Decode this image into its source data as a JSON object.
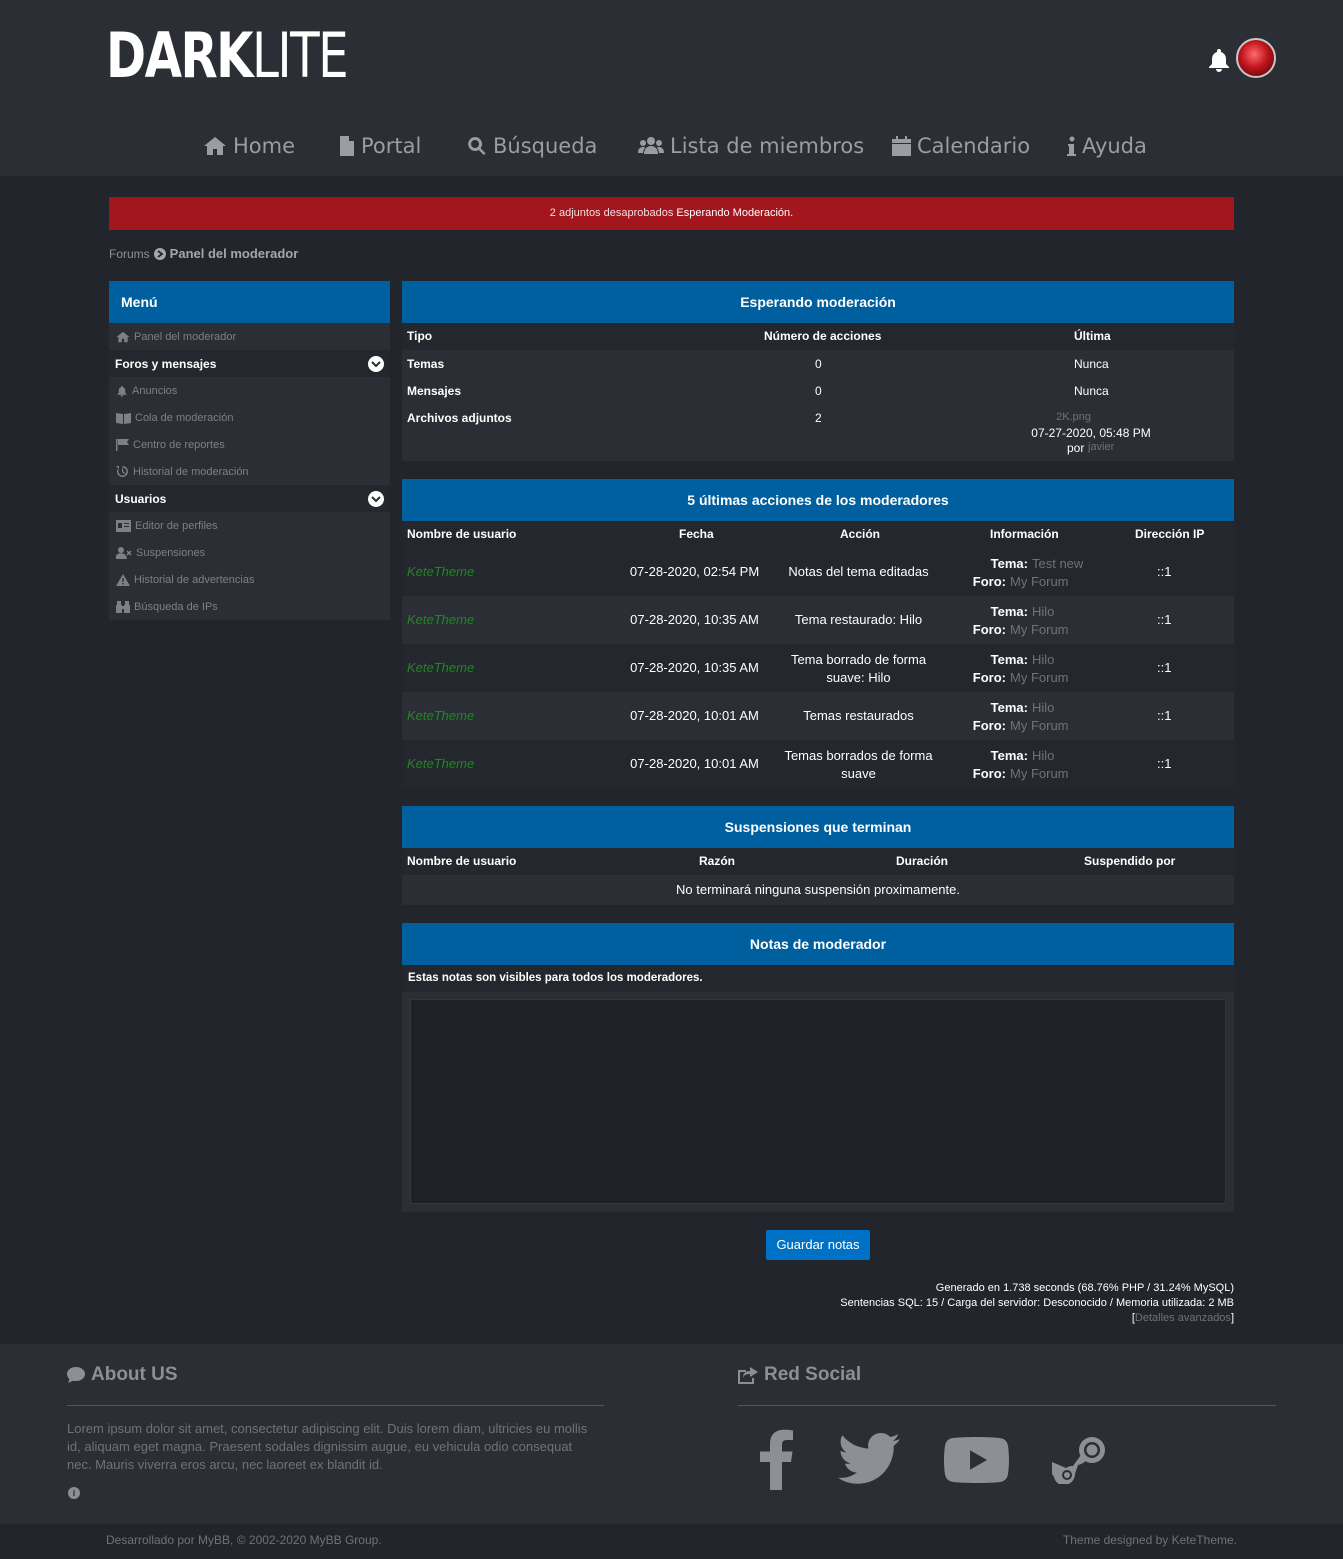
{
  "header": {
    "logo_bold": "DARK",
    "logo_light": "LITE",
    "nav": [
      {
        "label": "Home",
        "icon": "home-icon"
      },
      {
        "label": "Portal",
        "icon": "file-icon"
      },
      {
        "label": "Búsqueda",
        "icon": "search-icon"
      },
      {
        "label": "Lista de miembros",
        "icon": "users-icon"
      },
      {
        "label": "Calendario",
        "icon": "calendar-icon"
      },
      {
        "label": "Ayuda",
        "icon": "info-icon"
      }
    ]
  },
  "alert": {
    "text": "2 adjuntos desaprobados ",
    "link": "Esperando Moderación."
  },
  "breadcrumb": {
    "root": "Forums",
    "current": "Panel del moderador"
  },
  "menu": {
    "title": "Menú",
    "top_item": "Panel del moderador",
    "section1": "Foros y mensajes",
    "section1_items": [
      "Anuncios",
      "Cola de moderación",
      "Centro de reportes",
      "Historial de moderación"
    ],
    "section2": "Usuarios",
    "section2_items": [
      "Editor de perfiles",
      "Suspensiones",
      "Historial de advertencias",
      "Búsqueda de IPs"
    ]
  },
  "awaiting": {
    "title": "Esperando moderación",
    "cols": [
      "Tipo",
      "Número de acciones",
      "Última"
    ],
    "rows": [
      {
        "type": "Temas",
        "count": "0",
        "last": "Nunca"
      },
      {
        "type": "Mensajes",
        "count": "0",
        "last": "Nunca"
      },
      {
        "type": "Archivos adjuntos",
        "count": "2",
        "last_file": "2K.png",
        "last_date": "07-27-2020, 05:48 PM",
        "by_label": "por",
        "by_user": "javier"
      }
    ]
  },
  "actions": {
    "title": "5 últimas acciones de los moderadores",
    "cols": [
      "Nombre de usuario",
      "Fecha",
      "Acción",
      "Información",
      "Dirección IP"
    ],
    "tema_label": "Tema:",
    "foro_label": "Foro:",
    "rows": [
      {
        "user": "KeteTheme",
        "date": "07-28-2020, 02:54 PM",
        "action1": "Notas del tema editadas",
        "action2": "",
        "tema": "Test new",
        "foro": "My Forum",
        "ip": "::1"
      },
      {
        "user": "KeteTheme",
        "date": "07-28-2020, 10:35 AM",
        "action1": "Tema restaurado: Hilo",
        "action2": "",
        "tema": "Hilo",
        "foro": "My Forum",
        "ip": "::1"
      },
      {
        "user": "KeteTheme",
        "date": "07-28-2020, 10:35 AM",
        "action1": "Tema borrado de forma",
        "action2": "suave: Hilo",
        "tema": "Hilo",
        "foro": "My Forum",
        "ip": "::1"
      },
      {
        "user": "KeteTheme",
        "date": "07-28-2020, 10:01 AM",
        "action1": "Temas restaurados",
        "action2": "",
        "tema": "Hilo",
        "foro": "My Forum",
        "ip": "::1"
      },
      {
        "user": "KeteTheme",
        "date": "07-28-2020, 10:01 AM",
        "action1": "Temas borrados de forma",
        "action2": "suave",
        "tema": "Hilo",
        "foro": "My Forum",
        "ip": "::1"
      }
    ]
  },
  "suspensions": {
    "title": "Suspensiones que terminan",
    "cols": [
      "Nombre de usuario",
      "Razón",
      "Duración",
      "Suspendido por"
    ],
    "empty": "No terminará ninguna suspensión proximamente."
  },
  "notes": {
    "title": "Notas de moderador",
    "subtitle": "Estas notas son visibles para todos los moderadores.",
    "value": "",
    "save_label": "Guardar notas"
  },
  "stats": {
    "line1": "Generado en 1.738 seconds (68.76% PHP / 31.24% MySQL)",
    "line2": "Sentencias SQL: 15 / Carga del servidor: Desconocido / Memoria utilizada: 2 MB",
    "open": "[",
    "link": "Detalles avanzados",
    "close": "]"
  },
  "footer": {
    "about_title": "About US",
    "about_text": "Lorem ipsum dolor sit amet, consectetur adipiscing elit. Duis lorem diam, ultricies eu mollis id, aliquam eget magna. Praesent sodales dignissim augue, eu vehicula odio consequat nec. Mauris viverra eros arcu, nec laoreet ex blandit id.",
    "social_title": "Red Social",
    "social": [
      "facebook-icon",
      "twitter-icon",
      "youtube-icon",
      "steam-icon"
    ],
    "copyright": "Desarrollado por MyBB, © 2002-2020 MyBB Group.",
    "designer": "Theme designed by KeteTheme."
  },
  "colors": {
    "accent": "#005f9e",
    "alert": "#a3161d",
    "user": "#1a8b1f",
    "button": "#0072c6"
  }
}
